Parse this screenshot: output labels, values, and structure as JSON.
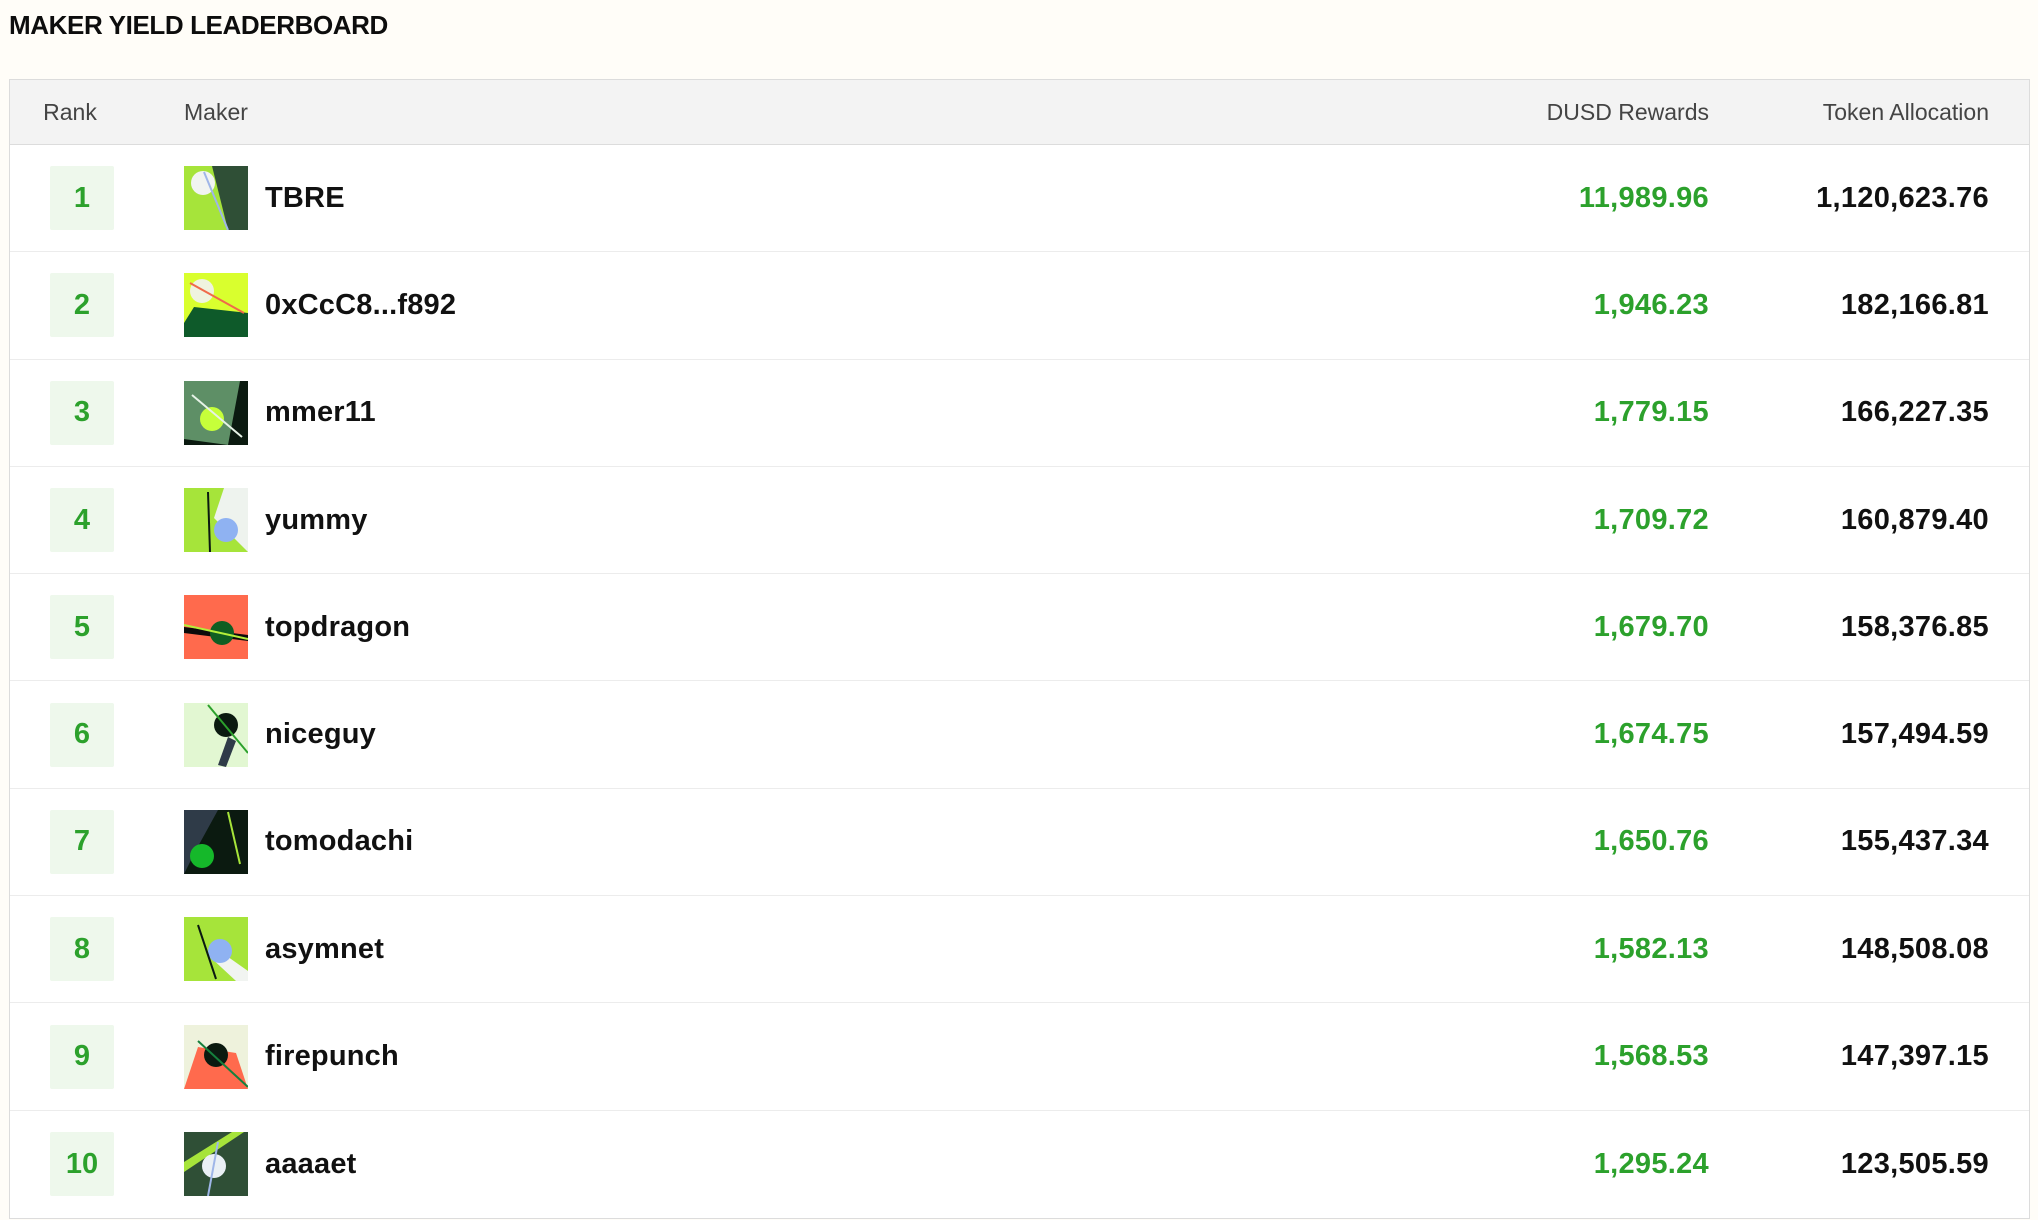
{
  "page": {
    "title": "MAKER YIELD LEADERBOARD"
  },
  "table": {
    "headers": {
      "rank": "Rank",
      "maker": "Maker",
      "dusd": "DUSD Rewards",
      "token": "Token Allocation"
    },
    "rows": [
      {
        "rank": "1",
        "maker": "TBRE",
        "dusd": "11,989.96",
        "token": "1,120,623.76",
        "avatar_icon": "abstract-avatar-icon"
      },
      {
        "rank": "2",
        "maker": "0xCcC8...f892",
        "dusd": "1,946.23",
        "token": "182,166.81",
        "avatar_icon": "abstract-avatar-icon"
      },
      {
        "rank": "3",
        "maker": "mmer11",
        "dusd": "1,779.15",
        "token": "166,227.35",
        "avatar_icon": "abstract-avatar-icon"
      },
      {
        "rank": "4",
        "maker": "yummy",
        "dusd": "1,709.72",
        "token": "160,879.40",
        "avatar_icon": "abstract-avatar-icon"
      },
      {
        "rank": "5",
        "maker": "topdragon",
        "dusd": "1,679.70",
        "token": "158,376.85",
        "avatar_icon": "abstract-avatar-icon"
      },
      {
        "rank": "6",
        "maker": "niceguy",
        "dusd": "1,674.75",
        "token": "157,494.59",
        "avatar_icon": "abstract-avatar-icon"
      },
      {
        "rank": "7",
        "maker": "tomodachi",
        "dusd": "1,650.76",
        "token": "155,437.34",
        "avatar_icon": "abstract-avatar-icon"
      },
      {
        "rank": "8",
        "maker": "asymnet",
        "dusd": "1,582.13",
        "token": "148,508.08",
        "avatar_icon": "abstract-avatar-icon"
      },
      {
        "rank": "9",
        "maker": "firepunch",
        "dusd": "1,568.53",
        "token": "147,397.15",
        "avatar_icon": "abstract-avatar-icon"
      },
      {
        "rank": "10",
        "maker": "aaaaet",
        "dusd": "1,295.24",
        "token": "123,505.59",
        "avatar_icon": "abstract-avatar-icon"
      }
    ]
  },
  "colors": {
    "accent_green": "#2ca12c",
    "rank_badge_bg": "#eef8ec",
    "header_bg": "#f3f3f3",
    "page_bg": "#fffdf8"
  }
}
